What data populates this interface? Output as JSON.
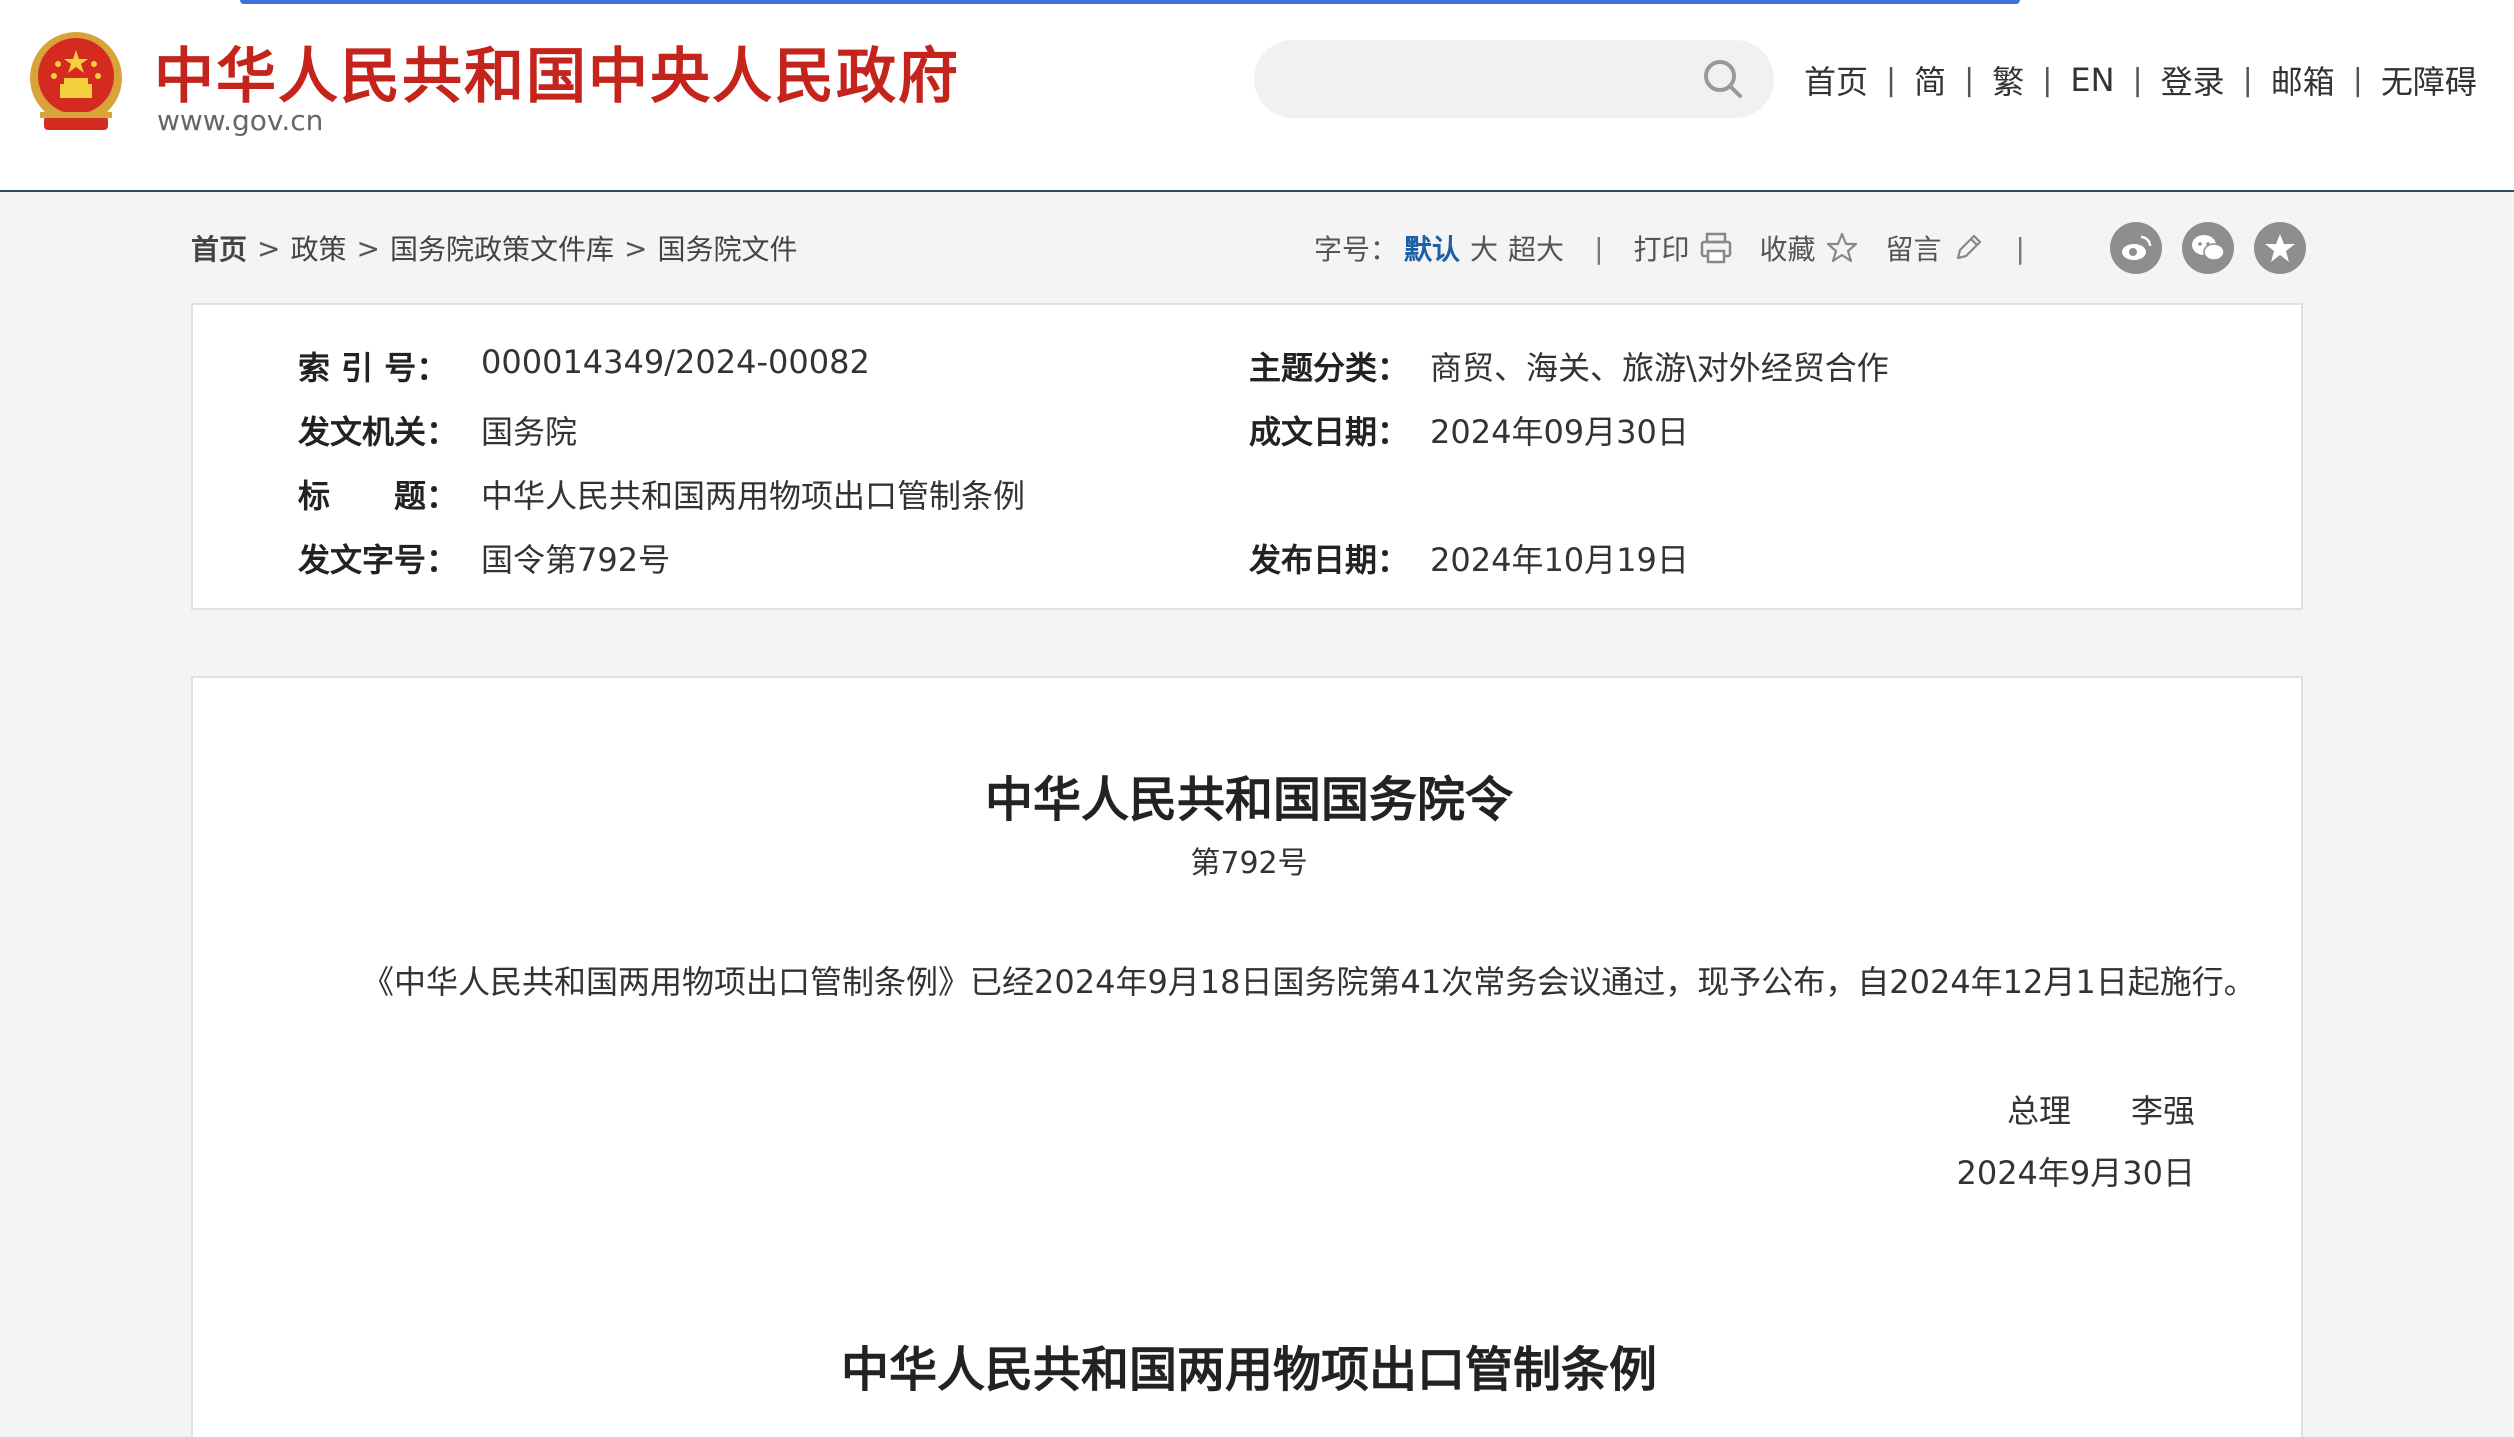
{
  "header": {
    "site_name": "中华人民共和国中央人民政府",
    "site_domain": "www.gov.cn",
    "search_placeholder": "",
    "nav": [
      "首页",
      "简",
      "繁",
      "EN",
      "登录",
      "邮箱",
      "无障碍"
    ],
    "nav_separator": "|"
  },
  "breadcrumb": {
    "items": [
      "首页",
      "政策",
      "国务院政策文件库",
      "国务院文件"
    ],
    "separator": ">"
  },
  "tools": {
    "font_size_label": "字号：",
    "font_sizes": [
      "默认",
      "大",
      "超大"
    ],
    "print_label": "打印",
    "favorite_label": "收藏",
    "comment_label": "留言",
    "separator": "|",
    "share_icons": [
      "weibo-icon",
      "wechat-icon",
      "qzone-icon"
    ]
  },
  "meta": {
    "index_no_label": "索 引 号：",
    "index_no": "000014349/2024-00082",
    "category_label": "主题分类：",
    "category": "商贸、海关、旅游\\对外经贸合作",
    "issuer_label": "发文机关：",
    "issuer": "国务院",
    "written_date_label": "成文日期：",
    "written_date": "2024年09月30日",
    "title_label": "标　　题：",
    "title": "中华人民共和国两用物项出口管制条例",
    "doc_no_label": "发文字号：",
    "doc_no": "国令第792号",
    "publish_date_label": "发布日期：",
    "publish_date": "2024年10月19日"
  },
  "document": {
    "title": "中华人民共和国国务院令",
    "number": "第792号",
    "body": "《中华人民共和国两用物项出口管制条例》已经2024年9月18日国务院第41次常务会议通过，现予公布，自2024年12月1日起施行。",
    "signer_title": "总理",
    "signer_name": "李强",
    "date": "2024年9月30日",
    "subtitle": "中华人民共和国两用物项出口管制条例"
  },
  "colors": {
    "brand_red": "#c4241b",
    "link_blue": "#1d5fa8",
    "header_border": "#2a4a6e"
  }
}
